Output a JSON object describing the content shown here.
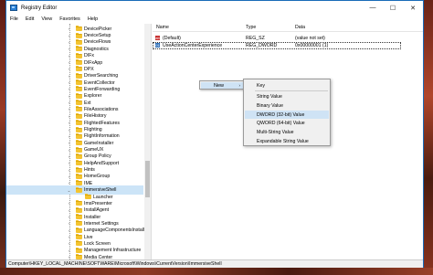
{
  "window": {
    "title": "Registry Editor"
  },
  "window_controls": {
    "minimize": "—",
    "maximize": "☐",
    "close": "✕"
  },
  "menu": [
    "File",
    "Edit",
    "View",
    "Favorites",
    "Help"
  ],
  "tree": {
    "items": [
      {
        "label": "DevicePicker",
        "expander": "›"
      },
      {
        "label": "DeviceSetup",
        "expander": "›"
      },
      {
        "label": "DeviceFlows",
        "expander": "›"
      },
      {
        "label": "Diagnostics",
        "expander": "›"
      },
      {
        "label": "DIFx",
        "expander": "›"
      },
      {
        "label": "DIFxApp",
        "expander": "›"
      },
      {
        "label": "DPX",
        "expander": "›"
      },
      {
        "label": "DriverSearching",
        "expander": "›"
      },
      {
        "label": "EventCollector",
        "expander": "›"
      },
      {
        "label": "EventForwarding",
        "expander": "›"
      },
      {
        "label": "Explorer",
        "expander": "›"
      },
      {
        "label": "Ext",
        "expander": "›"
      },
      {
        "label": "FileAssociations",
        "expander": "›"
      },
      {
        "label": "FileHistory",
        "expander": "›"
      },
      {
        "label": "FlightedFeatures",
        "expander": "›"
      },
      {
        "label": "Flighting",
        "expander": "›"
      },
      {
        "label": "FlightInformation",
        "expander": "›"
      },
      {
        "label": "GameInstaller",
        "expander": "›"
      },
      {
        "label": "GameUX",
        "expander": "›"
      },
      {
        "label": "Group Policy",
        "expander": "›"
      },
      {
        "label": "HelpAndSupport",
        "expander": "›"
      },
      {
        "label": "Hints",
        "expander": "›"
      },
      {
        "label": "HomeGroup",
        "expander": "›"
      },
      {
        "label": "IME",
        "expander": "›"
      },
      {
        "label": "ImmersiveShell",
        "expander": "⌄"
      },
      {
        "label": "Launcher",
        "expander": ""
      },
      {
        "label": "ImsPresenter",
        "expander": "›"
      },
      {
        "label": "InstallAgent",
        "expander": "›"
      },
      {
        "label": "Installer",
        "expander": "›"
      },
      {
        "label": "Internet Settings",
        "expander": "›"
      },
      {
        "label": "LanguageComponentsInstaller",
        "expander": "›"
      },
      {
        "label": "Live",
        "expander": "›"
      },
      {
        "label": "Lock Screen",
        "expander": "›"
      },
      {
        "label": "Management Infrastructure",
        "expander": "›"
      },
      {
        "label": "Media Center",
        "expander": "›"
      }
    ]
  },
  "list": {
    "headers": {
      "name": "Name",
      "type": "Type",
      "data": "Data"
    },
    "rows": [
      {
        "name": "(Default)",
        "type": "REG_SZ",
        "data": "(value not set)",
        "icon": "ab"
      },
      {
        "name": "UseActionCenterExperience",
        "type": "REG_DWORD",
        "data": "0x00000001 (1)",
        "icon": "01"
      }
    ]
  },
  "context_menu": {
    "new_label": "New",
    "arrow": "›"
  },
  "submenu": {
    "items": [
      "Key",
      "String Value",
      "Binary Value",
      "DWORD (32-bit) Value",
      "QWORD (64-bit) Value",
      "Multi-String Value",
      "Expandable String Value"
    ]
  },
  "status": {
    "path": "Computer\\HKEY_LOCAL_MACHINE\\SOFTWARE\\Microsoft\\Windows\\CurrentVersion\\ImmersiveShell"
  },
  "colors": {
    "selection": "#cce4f7",
    "menu_highlight": "#cfe3f5",
    "window_border": "#1a6bb8"
  }
}
